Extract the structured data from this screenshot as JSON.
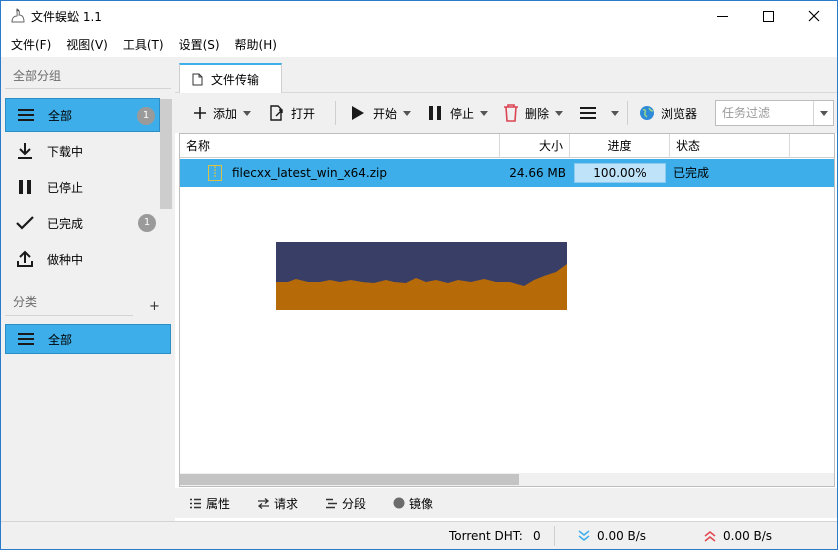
{
  "window": {
    "title": "文件蜈蚣 1.1"
  },
  "menu": [
    {
      "label": "文件(F)"
    },
    {
      "label": "视图(V)"
    },
    {
      "label": "工具(T)"
    },
    {
      "label": "设置(S)"
    },
    {
      "label": "帮助(H)"
    }
  ],
  "sidebar": {
    "groups_header": "全部分组",
    "groups": [
      {
        "label": "全部",
        "icon": "menu-lines-icon",
        "badge": "1",
        "selected": true
      },
      {
        "label": "下载中",
        "icon": "download-icon"
      },
      {
        "label": "已停止",
        "icon": "pause-icon"
      },
      {
        "label": "已完成",
        "icon": "check-icon",
        "badge": "1"
      },
      {
        "label": "做种中",
        "icon": "upload-icon"
      }
    ],
    "categories_header": "分类",
    "add_label": "+",
    "categories": [
      {
        "label": "全部",
        "icon": "menu-lines-icon",
        "selected": true
      }
    ]
  },
  "tab": {
    "label": "文件传输"
  },
  "toolbar": {
    "add": "添加",
    "open": "打开",
    "start": "开始",
    "stop": "停止",
    "delete": "删除",
    "browser": "浏览器",
    "filter_placeholder": "任务过滤"
  },
  "table": {
    "columns": [
      "名称",
      "大小",
      "进度",
      "状态"
    ],
    "rows": [
      {
        "name": "filecxx_latest_win_x64.zip",
        "size": "24.66 MB",
        "progress": "100.00%",
        "status": "已完成",
        "progress_fraction": 1.0
      }
    ]
  },
  "bottom_tabs": [
    {
      "label": "属性",
      "icon": "properties-icon"
    },
    {
      "label": "请求",
      "icon": "request-icon"
    },
    {
      "label": "分段",
      "icon": "segments-icon"
    },
    {
      "label": "镜像",
      "icon": "mirror-icon"
    }
  ],
  "status": {
    "dht_label": "Torrent DHT:",
    "dht_value": "0",
    "download_speed": "0.00 B/s",
    "upload_speed": "0.00 B/s"
  },
  "colors": {
    "accent": "#3daee9",
    "art_sky": "#383e66",
    "art_ground": "#b66a08",
    "delete_icon": "#da4453",
    "download_speed": "#3daee9",
    "upload_speed": "#e0474f"
  }
}
